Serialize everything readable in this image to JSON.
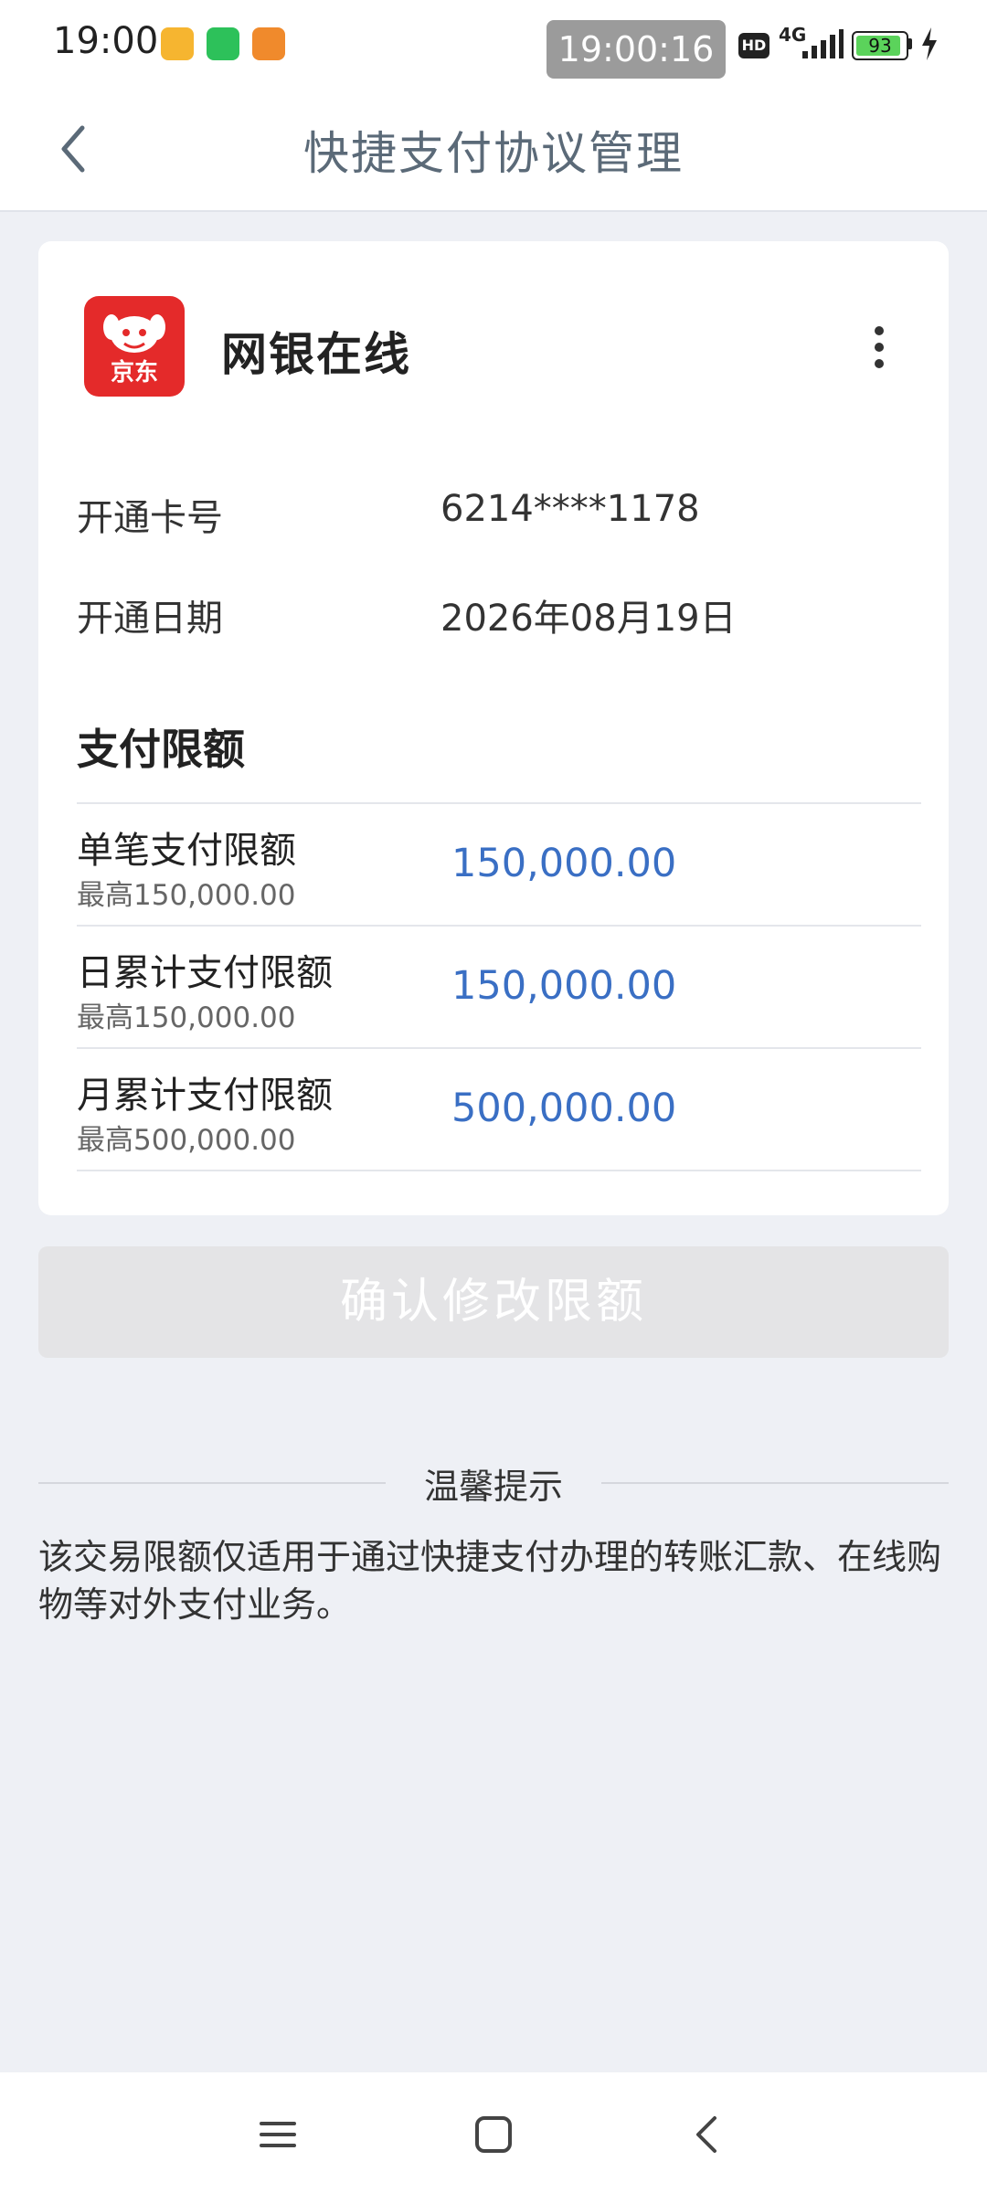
{
  "status": {
    "time": "19:00",
    "recording_time": "19:00:16",
    "hd": "HD",
    "network": "4G",
    "battery": "93",
    "battery_level": 0.93,
    "icons": [
      "notes-app-icon",
      "wechat-icon",
      "video-app-icon",
      "signal-icon",
      "charging-icon"
    ]
  },
  "header": {
    "title": "快捷支付协议管理",
    "back_icon": "back-arrow-icon"
  },
  "merchant": {
    "logo_text": "京东",
    "name": "网银在线",
    "more_icon": "more-vertical-icon"
  },
  "info": {
    "card_label": "开通卡号",
    "card_value": "6214****1178",
    "date_label": "开通日期",
    "date_value": "2026年08月19日"
  },
  "limits": {
    "title": "支付限额",
    "items": [
      {
        "name": "单笔支付限额",
        "max": "最高150,000.00",
        "value": "150,000.00"
      },
      {
        "name": "日累计支付限额",
        "max": "最高150,000.00",
        "value": "150,000.00"
      },
      {
        "name": "月累计支付限额",
        "max": "最高500,000.00",
        "value": "500,000.00"
      }
    ]
  },
  "confirm_label": "确认修改限额",
  "tips": {
    "title": "温馨提示",
    "text": "该交易限额仅适用于通过快捷支付办理的转账汇款、在线购物等对外支付业务。"
  },
  "colors": {
    "accent": "#3a6fc4",
    "logo_red": "#e42a2a",
    "background": "#eef0f5"
  }
}
